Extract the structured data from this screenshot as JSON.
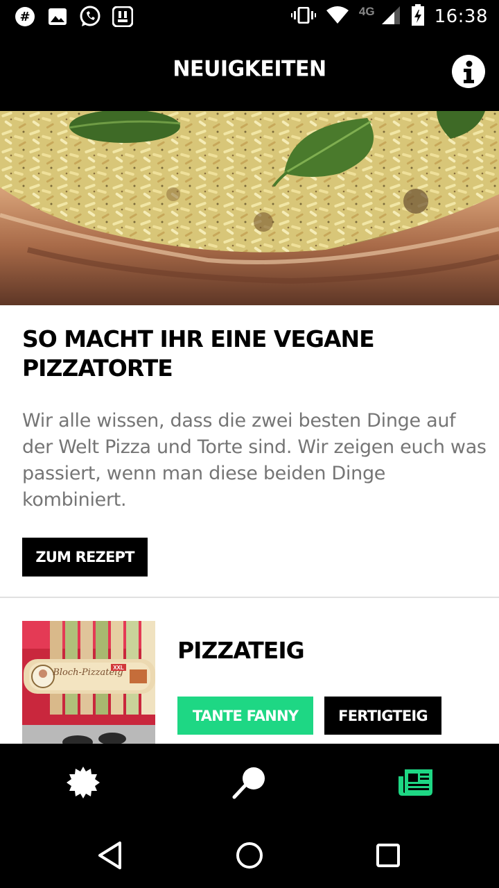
{
  "status_bar": {
    "time": "16:38",
    "network": "4G",
    "left_icons": [
      "slack-icon",
      "image-icon",
      "whatsapp-icon",
      "app-icon"
    ],
    "right_icons": [
      "vibrate-icon",
      "wifi-icon",
      "signal-icon",
      "battery-icon"
    ]
  },
  "header": {
    "title": "NEUIGKEITEN",
    "info_icon": "info-icon"
  },
  "article": {
    "title": "SO MACHT IHR EINE VEGANE PIZZATORTE",
    "text": "Wir alle wissen, dass die zwei besten Dinge auf der Welt Pizza und Torte sind. Wir zeigen euch was passiert, wenn man diese beiden Dinge kombiniert.",
    "button_label": "ZUM REZEPT"
  },
  "card2": {
    "title": "PIZZATEIG",
    "tags": [
      "TANTE FANNY",
      "FERTIGTEIG"
    ]
  },
  "bottom_nav": {
    "items": [
      "badge-icon",
      "search-icon",
      "news-icon"
    ],
    "active": "news-icon",
    "active_color": "#1ed784"
  },
  "system_nav": [
    "back-icon",
    "home-icon",
    "recents-icon"
  ],
  "colors": {
    "accent": "#1ed784",
    "bar": "#000000",
    "body_text": "#757575"
  }
}
